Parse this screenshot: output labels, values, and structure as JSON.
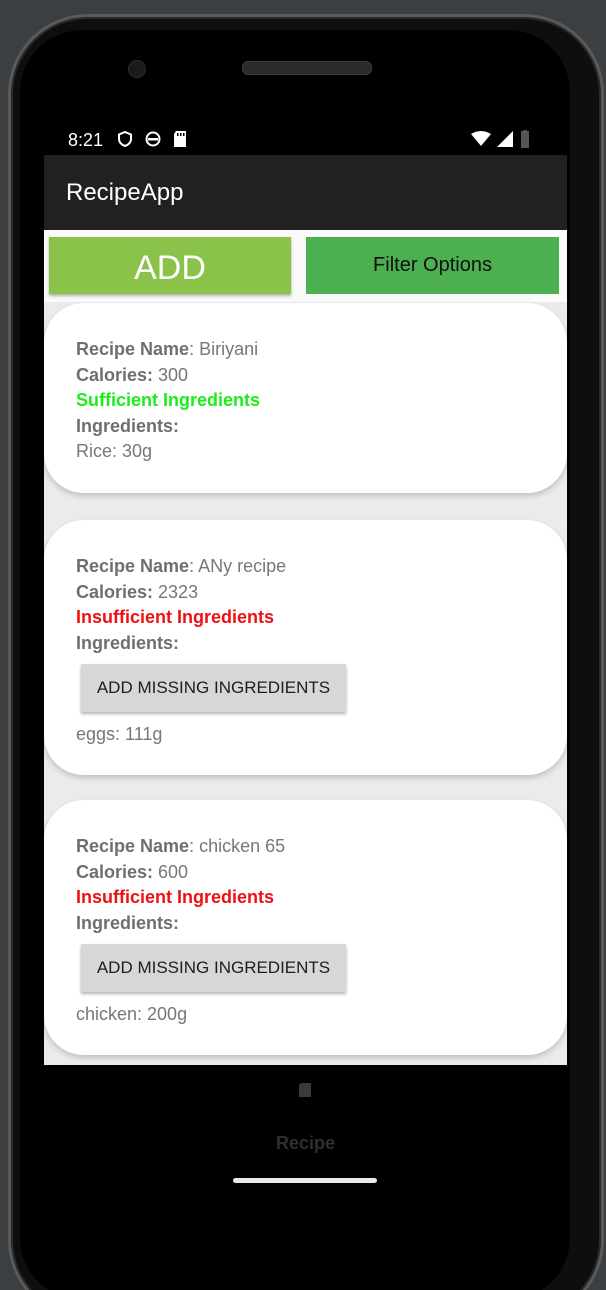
{
  "status_bar": {
    "time": "8:21"
  },
  "app_bar": {
    "title": "RecipeApp"
  },
  "actions": {
    "add_label": "ADD",
    "filter_label": "Filter Options"
  },
  "labels": {
    "recipe_name": "Recipe Name",
    "calories": "Calories:",
    "ingredients": "Ingredients:",
    "add_missing": "ADD MISSING INGREDIENTS"
  },
  "recipes": [
    {
      "name": ": Biriyani",
      "calories": " 300",
      "status": "Sufficient Ingredients",
      "ingredients": [
        "Rice: 30g"
      ]
    },
    {
      "name": ": ANy recipe",
      "calories": " 2323",
      "status": "Insufficient Ingredients",
      "ingredients": [
        "eggs: 111g"
      ]
    },
    {
      "name": ": chicken 65",
      "calories": " 600",
      "status": "Insufficient Ingredients",
      "ingredients": [
        "chicken: 200g"
      ]
    }
  ],
  "bottom_nav": {
    "label": "Recipe",
    "icon": "sd-card-icon"
  },
  "colors": {
    "sufficient": "#1aee1a",
    "insufficient": "#ee1111",
    "add_button": "#8bc34a",
    "filter_button": "#4caf50",
    "app_bar": "#212121"
  }
}
